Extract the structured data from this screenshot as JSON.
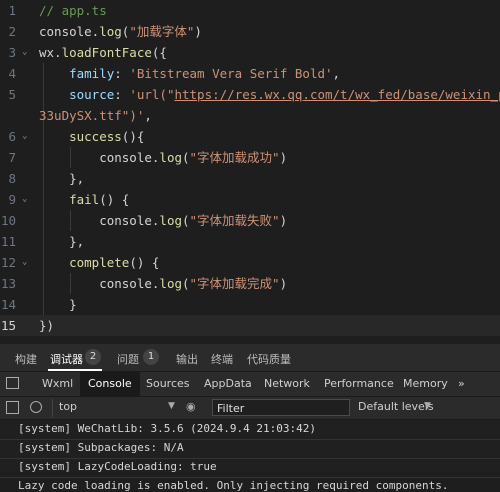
{
  "editor": {
    "lines": [
      {
        "n": "1",
        "html_parts": [
          [
            "c-comment",
            "// app.ts"
          ]
        ]
      },
      {
        "n": "2",
        "html_parts": [
          [
            "c-plain",
            "console."
          ],
          [
            "c-fn",
            "log"
          ],
          [
            "c-plain",
            "("
          ],
          [
            "c-str",
            "\"加载字体\""
          ],
          [
            "c-plain",
            ")"
          ]
        ]
      },
      {
        "n": "3",
        "html_parts": [
          [
            "c-plain",
            "wx."
          ],
          [
            "c-fn",
            "loadFontFace"
          ],
          [
            "c-plain",
            "({"
          ]
        ]
      },
      {
        "n": "4",
        "html_parts": [
          [
            "c-prop",
            "    family"
          ],
          [
            "c-plain",
            ": "
          ],
          [
            "c-str",
            "'Bitstream Vera Serif Bold'"
          ],
          [
            "c-plain",
            ","
          ]
        ]
      },
      {
        "n": "5",
        "html_parts": [
          [
            "c-prop",
            "    source"
          ],
          [
            "c-plain",
            ": "
          ],
          [
            "c-str",
            "'url(\""
          ],
          [
            "url",
            "https://res.wx.qq.com/t/wx_fed/base/weixin_portal/re"
          ]
        ]
      },
      {
        "n": "",
        "html_parts": [
          [
            "c-str",
            "33uDySX.ttf"
          ],
          [
            "c-str",
            "\")'"
          ],
          [
            "c-plain",
            ","
          ]
        ]
      },
      {
        "n": "6",
        "html_parts": [
          [
            "c-fn",
            "    success"
          ],
          [
            "c-plain",
            "(){"
          ]
        ]
      },
      {
        "n": "7",
        "html_parts": [
          [
            "c-plain",
            "        console."
          ],
          [
            "c-fn",
            "log"
          ],
          [
            "c-plain",
            "("
          ],
          [
            "c-str",
            "\"字体加载成功\""
          ],
          [
            "c-plain",
            ")"
          ]
        ]
      },
      {
        "n": "8",
        "html_parts": [
          [
            "c-plain",
            "    },"
          ]
        ]
      },
      {
        "n": "9",
        "html_parts": [
          [
            "c-fn",
            "    fail"
          ],
          [
            "c-plain",
            "() {"
          ]
        ]
      },
      {
        "n": "10",
        "html_parts": [
          [
            "c-plain",
            "        console."
          ],
          [
            "c-fn",
            "log"
          ],
          [
            "c-plain",
            "("
          ],
          [
            "c-str",
            "\"字体加载失败\""
          ],
          [
            "c-plain",
            ")"
          ]
        ]
      },
      {
        "n": "11",
        "html_parts": [
          [
            "c-plain",
            "    },"
          ]
        ]
      },
      {
        "n": "12",
        "html_parts": [
          [
            "c-fn",
            "    complete"
          ],
          [
            "c-plain",
            "() {"
          ]
        ]
      },
      {
        "n": "13",
        "html_parts": [
          [
            "c-plain",
            "        console."
          ],
          [
            "c-fn",
            "log"
          ],
          [
            "c-plain",
            "("
          ],
          [
            "c-str",
            "\"字体加载完成\""
          ],
          [
            "c-plain",
            ")"
          ]
        ]
      },
      {
        "n": "14",
        "html_parts": [
          [
            "c-plain",
            "    }"
          ]
        ]
      },
      {
        "n": "15",
        "html_parts": [
          [
            "c-plain",
            "})"
          ]
        ]
      }
    ]
  },
  "panel_tabs": {
    "build": "构建",
    "debugger": "调试器",
    "debugger_count": "2",
    "issues": "问题",
    "issues_count": "1",
    "output": "输出",
    "terminal": "终端",
    "code_quality": "代码质量"
  },
  "devtools_tabs": {
    "wxml": "Wxml",
    "console": "Console",
    "sources": "Sources",
    "appdata": "AppData",
    "network": "Network",
    "performance": "Performance",
    "memory": "Memory",
    "more": "»"
  },
  "toolbar": {
    "context": "top",
    "filter_placeholder": "Filter",
    "levels": "Default levels"
  },
  "console": {
    "lines": [
      "[system] WeChatLib: 3.5.6 (2024.9.4 21:03:42)",
      "[system] Subpackages: N/A",
      "[system] LazyCodeLoading: true",
      "Lazy code loading is enabled. Only injecting required components."
    ]
  },
  "colors": {
    "editor_bg": "#1e1e1e",
    "panel_bg": "#2b2b2b",
    "string": "#ce9178",
    "function": "#dcdcaa",
    "property": "#9cdcfe",
    "comment": "#6a9955"
  }
}
